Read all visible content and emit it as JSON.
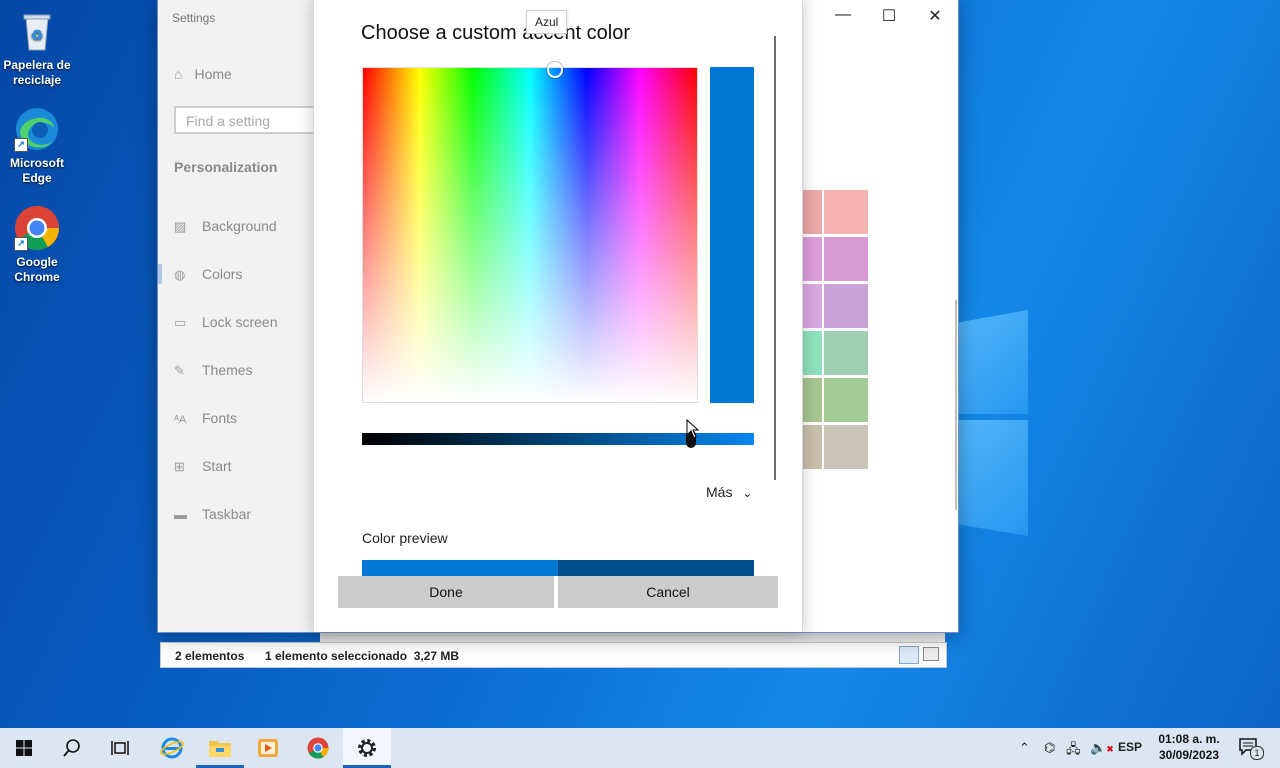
{
  "desktop": {
    "icons": [
      {
        "label": "Papelera de reciclaje",
        "icon": "recycle-bin-icon"
      },
      {
        "label": "Microsoft Edge",
        "icon": "edge-icon"
      },
      {
        "label": "Google Chrome",
        "icon": "chrome-icon"
      }
    ]
  },
  "explorer": {
    "status_count": "2 elementos",
    "status_selected": "1 elemento seleccionado  3,27 MB"
  },
  "settings": {
    "title": "Settings",
    "home": "Home",
    "search_placeholder": "Find a setting",
    "section": "Personalization",
    "nav": [
      {
        "label": "Background",
        "icon": "background-icon"
      },
      {
        "label": "Colors",
        "icon": "palette-icon"
      },
      {
        "label": "Lock screen",
        "icon": "lock-screen-icon"
      },
      {
        "label": "Themes",
        "icon": "themes-icon"
      },
      {
        "label": "Fonts",
        "icon": "fonts-icon"
      },
      {
        "label": "Start",
        "icon": "start-icon"
      },
      {
        "label": "Taskbar",
        "icon": "taskbar-icon"
      }
    ],
    "swatch_colors": [
      "#f6b3b3",
      "#d89ad2",
      "#caa3d6",
      "#9fcfb0",
      "#a3cc96",
      "#c9c4b8"
    ]
  },
  "dialog": {
    "title": "Choose a custom accent color",
    "tooltip": "Azul",
    "selected_color": "#0078d4",
    "brightness_fraction": 0.84,
    "more": "Más",
    "preview_label": "Color preview",
    "preview_colors": [
      "#0078d4",
      "#004e8c"
    ],
    "done": "Done",
    "cancel": "Cancel"
  },
  "taskbar": {
    "language": "ESP",
    "time": "01:08 a. m.",
    "date": "30/09/2023",
    "notifications": "1"
  }
}
